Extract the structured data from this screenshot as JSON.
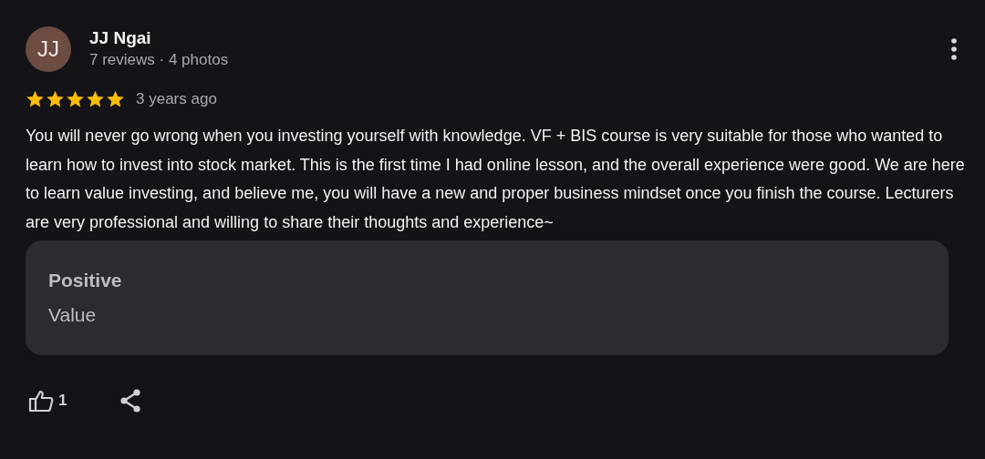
{
  "review": {
    "avatar_initials": "JJ",
    "author": "JJ Ngai",
    "author_stats": "7 reviews · 4 photos",
    "stars": 5,
    "time": "3 years ago",
    "text": "You will never go wrong when you investing yourself with knowledge. VF + BIS course is very suitable for those who wanted to learn how to invest into stock market. This is the first time I had online lesson, and the overall experience were good. We are here to learn value investing, and believe me, you will have a new and proper business mindset once you finish the course. Lecturers are very professional and willing to share their thoughts and experience~",
    "highlights": [
      {
        "label": "Positive",
        "value": "Value"
      }
    ],
    "like_count": "1"
  }
}
